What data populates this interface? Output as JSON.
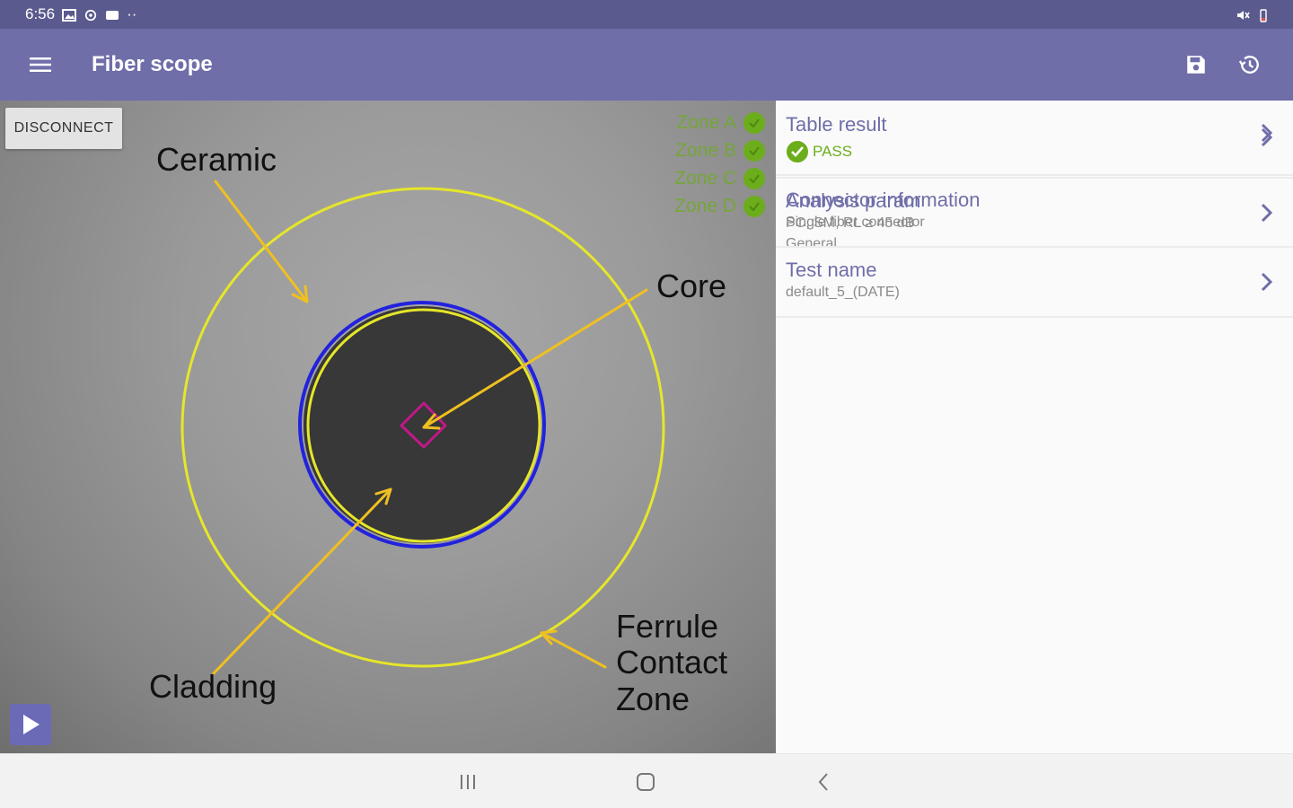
{
  "status": {
    "time": "6:56",
    "dots": "··"
  },
  "app": {
    "title": "Fiber scope"
  },
  "scope": {
    "disconnect_label": "DISCONNECT",
    "zones": [
      {
        "label": "Zone A"
      },
      {
        "label": "Zone B"
      },
      {
        "label": "Zone C"
      },
      {
        "label": "Zone D"
      }
    ],
    "annotations": {
      "ceramic": "Ceramic",
      "core": "Core",
      "cladding": "Cladding",
      "ferrule_1": "Ferrule",
      "ferrule_2": "Contact",
      "ferrule_3": "Zone"
    }
  },
  "list": {
    "table_result": {
      "title": "Table result",
      "status": "PASS"
    },
    "connector": {
      "title": "Connector information",
      "line1": "Single fiber connector",
      "line2": "General"
    },
    "analysis": {
      "title": "Analysis param",
      "line1": "PC, SM, RL ≥ 45 dB"
    },
    "test_name": {
      "title": "Test name",
      "line1": "default_5_(DATE)"
    }
  },
  "colors": {
    "app_bar": "#6f6ea9",
    "status_bar": "#5b5a8e",
    "pass_green": "#6cad1c",
    "zone_yellow": "#e6e62a",
    "arrow_orange": "#f0c020",
    "core_magenta": "#c2188a",
    "cladding_blue": "#2222dd"
  },
  "icons": {
    "menu": "menu-icon",
    "save": "save-icon",
    "history": "history-icon",
    "play": "play-icon",
    "chevron": "chevron-right-icon",
    "pass": "check-circle-icon"
  }
}
